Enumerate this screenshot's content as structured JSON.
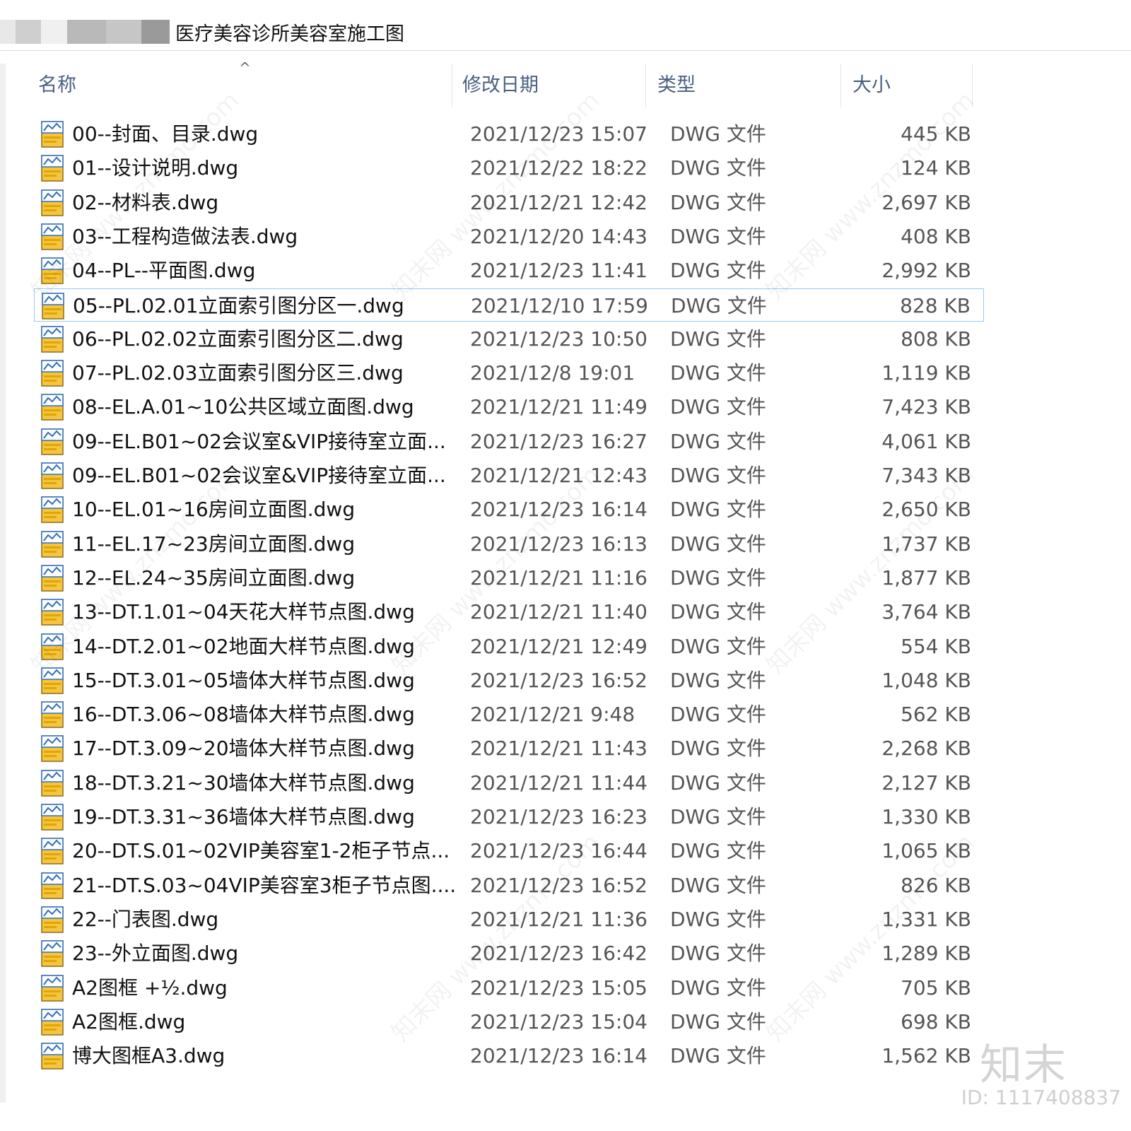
{
  "path": {
    "title": "医疗美容诊所美容室施工图"
  },
  "columns": {
    "name": "名称",
    "date": "修改日期",
    "type": "类型",
    "size": "大小"
  },
  "sort_indicator": "^",
  "files": [
    {
      "name": "00--封面、目录.dwg",
      "date": "2021/12/23 15:07",
      "type": "DWG 文件",
      "size": "445 KB"
    },
    {
      "name": "01--设计说明.dwg",
      "date": "2021/12/22 18:22",
      "type": "DWG 文件",
      "size": "124 KB"
    },
    {
      "name": "02--材料表.dwg",
      "date": "2021/12/21 12:42",
      "type": "DWG 文件",
      "size": "2,697 KB"
    },
    {
      "name": "03--工程构造做法表.dwg",
      "date": "2021/12/20 14:43",
      "type": "DWG 文件",
      "size": "408 KB"
    },
    {
      "name": "04--PL--平面图.dwg",
      "date": "2021/12/23 11:41",
      "type": "DWG 文件",
      "size": "2,992 KB"
    },
    {
      "name": "05--PL.02.01立面索引图分区一.dwg",
      "date": "2021/12/10 17:59",
      "type": "DWG 文件",
      "size": "828 KB"
    },
    {
      "name": "06--PL.02.02立面索引图分区二.dwg",
      "date": "2021/12/23 10:50",
      "type": "DWG 文件",
      "size": "808 KB"
    },
    {
      "name": "07--PL.02.03立面索引图分区三.dwg",
      "date": "2021/12/8 19:01",
      "type": "DWG 文件",
      "size": "1,119 KB"
    },
    {
      "name": "08--EL.A.01~10公共区域立面图.dwg",
      "date": "2021/12/21 11:49",
      "type": "DWG 文件",
      "size": "7,423 KB"
    },
    {
      "name": "09--EL.B01~02会议室&VIP接待室立面...",
      "date": "2021/12/23 16:27",
      "type": "DWG 文件",
      "size": "4,061 KB"
    },
    {
      "name": "09--EL.B01~02会议室&VIP接待室立面...",
      "date": "2021/12/21 12:43",
      "type": "DWG 文件",
      "size": "7,343 KB"
    },
    {
      "name": "10--EL.01~16房间立面图.dwg",
      "date": "2021/12/23 16:14",
      "type": "DWG 文件",
      "size": "2,650 KB"
    },
    {
      "name": "11--EL.17~23房间立面图.dwg",
      "date": "2021/12/23 16:13",
      "type": "DWG 文件",
      "size": "1,737 KB"
    },
    {
      "name": "12--EL.24~35房间立面图.dwg",
      "date": "2021/12/21 11:16",
      "type": "DWG 文件",
      "size": "1,877 KB"
    },
    {
      "name": "13--DT.1.01~04天花大样节点图.dwg",
      "date": "2021/12/21 11:40",
      "type": "DWG 文件",
      "size": "3,764 KB"
    },
    {
      "name": "14--DT.2.01~02地面大样节点图.dwg",
      "date": "2021/12/21 12:49",
      "type": "DWG 文件",
      "size": "554 KB"
    },
    {
      "name": "15--DT.3.01~05墙体大样节点图.dwg",
      "date": "2021/12/23 16:52",
      "type": "DWG 文件",
      "size": "1,048 KB"
    },
    {
      "name": "16--DT.3.06~08墙体大样节点图.dwg",
      "date": "2021/12/21 9:48",
      "type": "DWG 文件",
      "size": "562 KB"
    },
    {
      "name": "17--DT.3.09~20墙体大样节点图.dwg",
      "date": "2021/12/21 11:43",
      "type": "DWG 文件",
      "size": "2,268 KB"
    },
    {
      "name": "18--DT.3.21~30墙体大样节点图.dwg",
      "date": "2021/12/21 11:44",
      "type": "DWG 文件",
      "size": "2,127 KB"
    },
    {
      "name": "19--DT.3.31~36墙体大样节点图.dwg",
      "date": "2021/12/23 16:23",
      "type": "DWG 文件",
      "size": "1,330 KB"
    },
    {
      "name": "20--DT.S.01~02VIP美容室1-2柜子节点...",
      "date": "2021/12/23 16:44",
      "type": "DWG 文件",
      "size": "1,065 KB"
    },
    {
      "name": "21--DT.S.03~04VIP美容室3柜子节点图....",
      "date": "2021/12/23 16:52",
      "type": "DWG 文件",
      "size": "826 KB"
    },
    {
      "name": "22--门表图.dwg",
      "date": "2021/12/21 11:36",
      "type": "DWG 文件",
      "size": "1,331 KB"
    },
    {
      "name": "23--外立面图.dwg",
      "date": "2021/12/23 16:42",
      "type": "DWG 文件",
      "size": "1,289 KB"
    },
    {
      "name": "A2图框 +½.dwg",
      "date": "2021/12/23 15:05",
      "type": "DWG 文件",
      "size": "705 KB"
    },
    {
      "name": "A2图框.dwg",
      "date": "2021/12/23 15:04",
      "type": "DWG 文件",
      "size": "698 KB"
    },
    {
      "name": "博大图框A3.dwg",
      "date": "2021/12/23 16:14",
      "type": "DWG 文件",
      "size": "1,562 KB"
    }
  ],
  "selected_index": 5,
  "watermark": {
    "logo": "知末",
    "id": "ID: 1117408837",
    "diag": "知末网 www.znzmo.com"
  },
  "colors": {
    "selection_border": "#99c9ef",
    "header_text": "#4a6080",
    "icon_yellow": "#f5c542",
    "icon_blue": "#2e6fc2"
  }
}
